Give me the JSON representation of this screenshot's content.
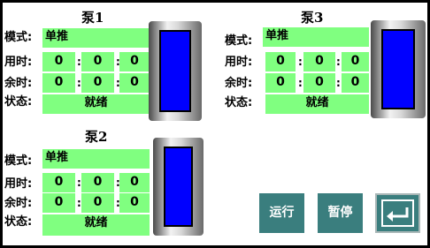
{
  "labels": {
    "mode": "模式:",
    "used": "用时:",
    "remain": "余时:",
    "status": "状态:",
    "colon": ":"
  },
  "pumps": [
    {
      "title": "泵1",
      "mode": "单推",
      "used": [
        "0",
        "0",
        "0"
      ],
      "remain": [
        "0",
        "0",
        "0"
      ],
      "status": "就绪",
      "level": 1.0,
      "fill_color": "#0000ff"
    },
    {
      "title": "泵3",
      "mode": "单推",
      "used": [
        "0",
        "0",
        "0"
      ],
      "remain": [
        "0",
        "0",
        "0"
      ],
      "status": "就绪",
      "level": 1.0,
      "fill_color": "#0000ff"
    },
    {
      "title": "泵2",
      "mode": "单推",
      "used": [
        "0",
        "0",
        "0"
      ],
      "remain": [
        "0",
        "0",
        "0"
      ],
      "status": "就绪",
      "level": 1.0,
      "fill_color": "#0000ff"
    }
  ],
  "buttons": {
    "run": "运行",
    "pause": "暂停",
    "back_icon": "return-arrow-icon"
  },
  "colors": {
    "field": "#80ff80",
    "button": "#3a7e7e",
    "fill": "#0000ff"
  }
}
